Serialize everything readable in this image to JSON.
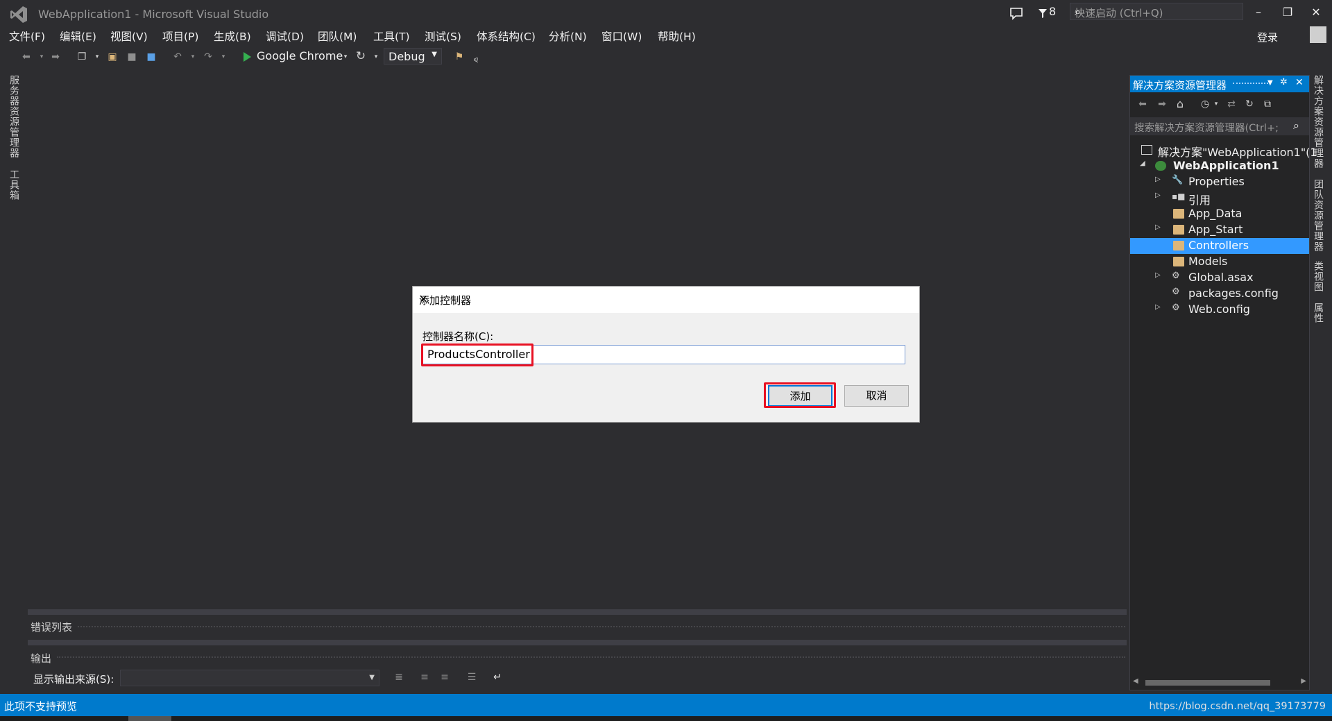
{
  "window": {
    "title": "WebApplication1 - Microsoft Visual Studio",
    "filter_count": "8",
    "quick_launch_placeholder": "快速启动 (Ctrl+Q)",
    "login": "登录"
  },
  "menu": [
    "文件(F)",
    "编辑(E)",
    "视图(V)",
    "项目(P)",
    "生成(B)",
    "调试(D)",
    "团队(M)",
    "工具(T)",
    "测试(S)",
    "体系结构(C)",
    "分析(N)",
    "窗口(W)",
    "帮助(H)"
  ],
  "toolbar": {
    "run_target": "Google Chrome",
    "configuration": "Debug"
  },
  "left_tabs": [
    "服务器资源管理器",
    "工具箱"
  ],
  "right_tabs": [
    "解决方案资源管理器",
    "团队资源管理器",
    "类视图",
    "属性"
  ],
  "solution_explorer": {
    "title": "解决方案资源管理器",
    "search_placeholder": "搜索解决方案资源管理器(Ctrl+;",
    "items": [
      {
        "label": "解决方案\"WebApplication1\"(1",
        "icon": "solution-icon"
      },
      {
        "label": "WebApplication1",
        "icon": "web-project-icon"
      },
      {
        "label": "Properties",
        "icon": "wrench-icon"
      },
      {
        "label": "引用",
        "icon": "references-icon"
      },
      {
        "label": "App_Data",
        "icon": "folder-icon"
      },
      {
        "label": "App_Start",
        "icon": "folder-icon"
      },
      {
        "label": "Controllers",
        "icon": "folder-icon"
      },
      {
        "label": "Models",
        "icon": "folder-icon"
      },
      {
        "label": "Global.asax",
        "icon": "global-asax-icon"
      },
      {
        "label": "packages.config",
        "icon": "config-file-icon"
      },
      {
        "label": "Web.config",
        "icon": "config-file-icon"
      }
    ],
    "selected": "Controllers"
  },
  "panels": {
    "error_list": "错误列表",
    "output": "输出",
    "output_source_label": "显示输出来源(S):"
  },
  "dialog": {
    "title": "添加控制器",
    "field_label": "控制器名称(C):",
    "field_value": "ProductsController",
    "add_button": "添加",
    "cancel_button": "取消"
  },
  "status": {
    "left": "此项不支持预览",
    "right": "https://blog.csdn.net/qq_39173779"
  },
  "colors": {
    "accent": "#007acc",
    "selection": "#3399ff",
    "highlight": "#e81123",
    "background": "#2d2d30"
  }
}
